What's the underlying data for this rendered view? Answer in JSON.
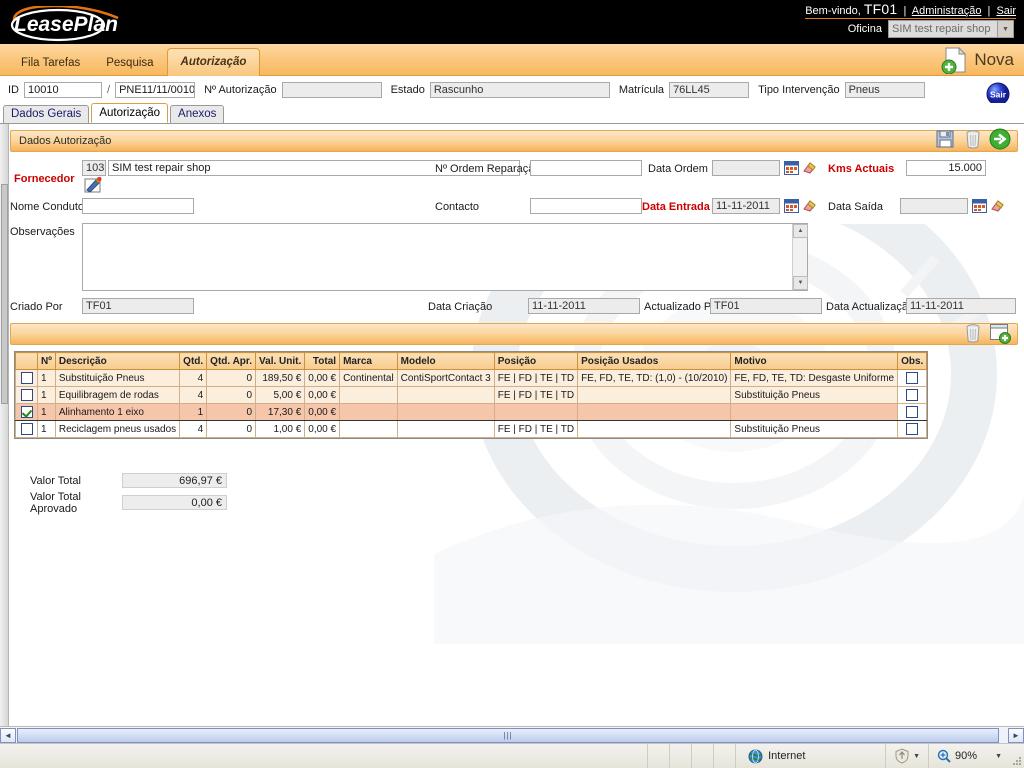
{
  "header": {
    "brand": "LeasePlan",
    "welcome_prefix": "Bem-vindo,",
    "username": "TF01",
    "admin_link": "Administração",
    "logout_link": "Sair",
    "oficina_label": "Oficina",
    "oficina_value": "SIM test repair shop"
  },
  "nav": {
    "tabs": [
      {
        "label": "Fila Tarefas",
        "active": false
      },
      {
        "label": "Pesquisa",
        "active": false
      },
      {
        "label": "Autorização",
        "active": true
      }
    ],
    "new_button": "Nova"
  },
  "idbar": {
    "id_label": "ID",
    "id_value": "10010",
    "separator": "/",
    "ref_value": "PNE11/11/0010",
    "auth_label": "Nº Autorização",
    "auth_value": "",
    "state_label": "Estado",
    "state_value": "Rascunho",
    "plate_label": "Matrícula",
    "plate_value": "76LL45",
    "intervention_label": "Tipo Intervenção",
    "intervention_value": "Pneus",
    "exit_button": "Sair"
  },
  "subtabs": [
    {
      "label": "Dados Gerais",
      "active": false
    },
    {
      "label": "Autorização",
      "active": true
    },
    {
      "label": "Anexos",
      "active": false
    }
  ],
  "section": {
    "title": "Dados Autorização"
  },
  "form": {
    "supplier_label": "Fornecedor",
    "supplier_code": "103",
    "supplier_name": "SIM test repair shop",
    "repair_order_label": "Nº Ordem Reparação",
    "repair_order_value": "",
    "order_date_label": "Data Ordem",
    "order_date_value": "",
    "kms_label": "Kms Actuais",
    "kms_value": "15.000",
    "driver_label": "Nome Condutor",
    "driver_value": "",
    "contact_label": "Contacto",
    "contact_value": "",
    "entry_date_label": "Data Entrada",
    "entry_date_value": "11-11-2011",
    "exit_date_label": "Data Saída",
    "exit_date_value": "",
    "notes_label": "Observações",
    "notes_value": "",
    "created_by_label": "Criado Por",
    "created_by_value": "TF01",
    "created_date_label": "Data Criação",
    "created_date_value": "11-11-2011",
    "updated_by_label": "Actualizado Por",
    "updated_by_value": "TF01",
    "updated_date_label": "Data Actualização",
    "updated_date_value": "11-11-2011"
  },
  "grid": {
    "columns": [
      "",
      "Nº",
      "Descrição",
      "Qtd.",
      "Qtd. Apr.",
      "Val. Unit.",
      "Total",
      "Marca",
      "Modelo",
      "Posição",
      "Posição Usados",
      "Motivo",
      "Obs."
    ],
    "rows": [
      {
        "checked": false,
        "style": "beige",
        "num": "1",
        "descricao": "Substituição Pneus",
        "qtd": "4",
        "qtd_apr": "0",
        "val_unit": "189,50 €",
        "total": "0,00 €",
        "marca": "Continental",
        "modelo": "ContiSportContact 3",
        "posicao": "FE | FD | TE | TD",
        "posicao_usados": "FE, FD, TE, TD: (1,0) - (10/2010)",
        "motivo": "FE, FD, TE, TD: Desgaste Uniforme"
      },
      {
        "checked": false,
        "style": "beige",
        "num": "1",
        "descricao": "Equilibragem de rodas",
        "qtd": "4",
        "qtd_apr": "0",
        "val_unit": "5,00 €",
        "total": "0,00 €",
        "marca": "",
        "modelo": "",
        "posicao": "FE | FD | TE | TD",
        "posicao_usados": "",
        "motivo": "Substituição Pneus"
      },
      {
        "checked": true,
        "style": "sel",
        "num": "1",
        "descricao": "Alinhamento 1 eixo",
        "qtd": "1",
        "qtd_apr": "0",
        "val_unit": "17,30 €",
        "total": "0,00 €",
        "marca": "",
        "modelo": "",
        "posicao": "",
        "posicao_usados": "",
        "motivo": ""
      },
      {
        "checked": false,
        "style": "white",
        "num": "1",
        "descricao": "Reciclagem pneus usados",
        "qtd": "4",
        "qtd_apr": "0",
        "val_unit": "1,00 €",
        "total": "0,00 €",
        "marca": "",
        "modelo": "",
        "posicao": "FE | FD | TE | TD",
        "posicao_usados": "",
        "motivo": "Substituição Pneus"
      }
    ]
  },
  "totals": {
    "total_label": "Valor Total",
    "total_value": "696,97 €",
    "approved_label": "Valor Total Aprovado",
    "approved_value": "0,00 €"
  },
  "statusbar": {
    "zone": "Internet",
    "zoom": "90%"
  },
  "colors": {
    "accent_orange": "#f6b45c",
    "required_red": "#cc0000",
    "brand_black": "#000000"
  }
}
